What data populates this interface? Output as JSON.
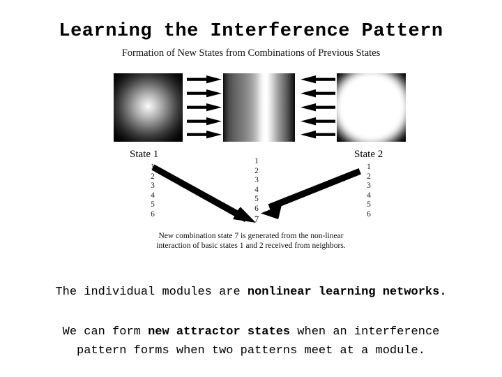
{
  "slide": {
    "title": "Learning the Interference Pattern",
    "subtitle": "Formation of New States from Combinations of Previous States"
  },
  "figure": {
    "panels": [
      {
        "name": "state-1-pattern",
        "type": "radial-soft-gradient"
      },
      {
        "name": "interference-pattern",
        "type": "vertical-fringes"
      },
      {
        "name": "state-2-pattern",
        "type": "radial-bright-disc"
      }
    ],
    "arrows_left_count": 5,
    "arrows_right_count": 5,
    "labels": {
      "state1": "State 1",
      "state2": "State 2"
    },
    "columns": {
      "left": [
        "1",
        "2",
        "3",
        "4",
        "5",
        "6"
      ],
      "center": [
        "1",
        "2",
        "3",
        "4",
        "5",
        "6",
        "7"
      ],
      "right": [
        "1",
        "2",
        "3",
        "4",
        "5",
        "6"
      ]
    },
    "caption_line1": "New combination state 7 is generated from the non-linear",
    "caption_line2": "interaction of basic states 1 and 2 received from neighbors."
  },
  "body": {
    "p1_prefix": "The individual modules are ",
    "p1_bold": "nonlinear learning networks.",
    "p1_suffix": "",
    "p2_prefix": "We can form ",
    "p2_bold": "new attractor states",
    "p2_suffix": " when an interference",
    "p2_line2": "pattern forms when two patterns meet at a module."
  },
  "colors": {
    "background": "#ffffff",
    "text": "#000000",
    "panel_background": "#000000"
  }
}
